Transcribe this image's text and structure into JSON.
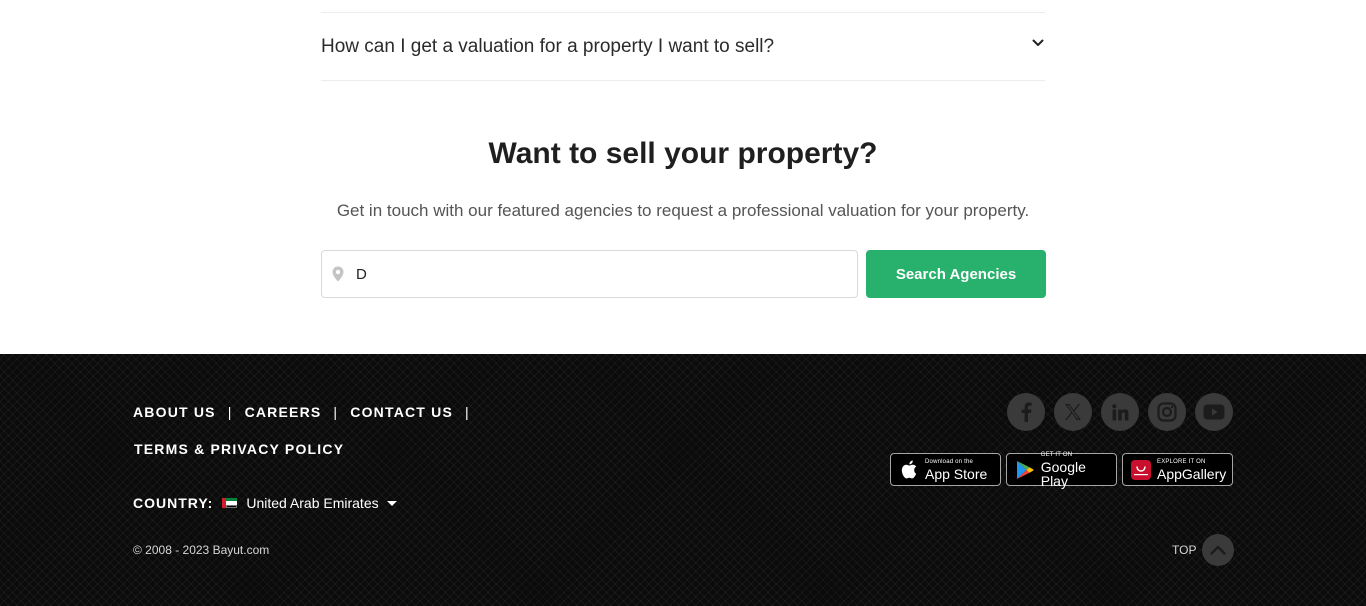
{
  "faq": {
    "question": "How can I get a valuation for a property I want to sell?",
    "chevron_icon": "chevron-down-icon"
  },
  "sell": {
    "title": "Want to sell your property?",
    "subtitle": "Get in touch with our featured agencies to request a professional valuation for your property.",
    "search_value": "D",
    "search_icon": "location-pin-icon",
    "search_button": "Search Agencies"
  },
  "footer": {
    "links": {
      "about": "ABOUT US",
      "careers": "CAREERS",
      "contact": "CONTACT US",
      "terms": "TERMS & PRIVACY POLICY",
      "separator": "|"
    },
    "country_label": "COUNTRY:",
    "country_value": "United Arab Emirates",
    "copyright": "© 2008 - 2023 Bayut.com",
    "socials": [
      "facebook-icon",
      "x-icon",
      "linkedin-icon",
      "instagram-icon",
      "youtube-icon"
    ],
    "stores": {
      "apple": {
        "small": "Download on the",
        "big": "App Store"
      },
      "google": {
        "small": "GET IT ON",
        "big": "Google Play"
      },
      "huawei": {
        "small": "EXPLORE IT ON",
        "big": "AppGallery"
      }
    },
    "top_label": "TOP"
  },
  "colors": {
    "accent": "#28b16d",
    "footer_bg": "#0b0b0b",
    "social_bg": "#3a3a3a"
  }
}
